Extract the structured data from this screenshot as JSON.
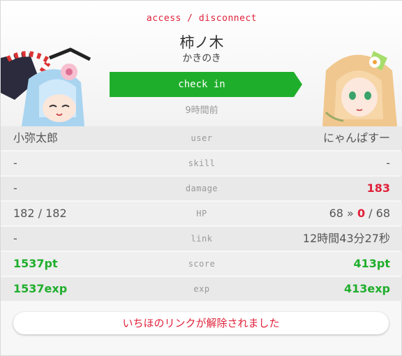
{
  "header": {
    "access_link": "access / disconnect",
    "name": "柿ノ木",
    "name_kana": "かきのき",
    "checkin_label": "check in",
    "last_checkin": "9時間前"
  },
  "rows": [
    {
      "left": "小弥太郎",
      "label": "user",
      "right": "にゃんぱすー"
    },
    {
      "left": "-",
      "label": "skill",
      "right": "-"
    },
    {
      "left": "-",
      "label": "damage",
      "right": "183"
    },
    {
      "left": "182 / 182",
      "label": "HP",
      "right_pre": "68 » ",
      "right_mid": "0",
      "right_post": " / 68"
    },
    {
      "left": "-",
      "label": "link",
      "right": "12時間43分27秒"
    },
    {
      "left": "1537pt",
      "label": "score",
      "right": "413pt"
    },
    {
      "left": "1537exp",
      "label": "exp",
      "right": "413exp"
    }
  ],
  "alert": "いちほのリンクが解除されました",
  "colors": {
    "accent_red": "#e0213a",
    "accent_green": "#1fae2c"
  }
}
